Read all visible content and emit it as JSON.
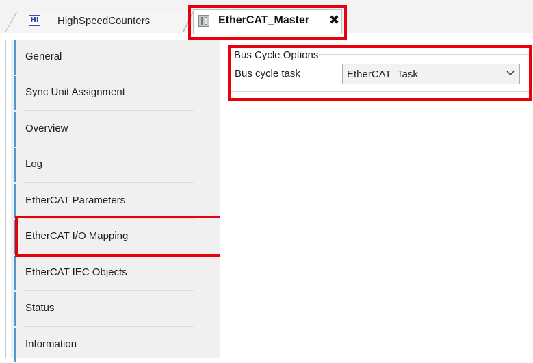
{
  "tabs": {
    "inactive_label": "HighSpeedCounters",
    "inactive_icon": "function-block-icon",
    "active_label": "EtherCAT_Master",
    "active_icon": "ethercat-master-icon",
    "close_glyph": "✖"
  },
  "nav": {
    "items": [
      {
        "label": "General"
      },
      {
        "label": "Sync Unit Assignment"
      },
      {
        "label": "Overview"
      },
      {
        "label": "Log"
      },
      {
        "label": "EtherCAT Parameters"
      },
      {
        "label": "EtherCAT I/O Mapping"
      },
      {
        "label": "EtherCAT IEC Objects"
      },
      {
        "label": "Status"
      },
      {
        "label": "Information"
      }
    ],
    "accent_color": "#4a9ad6"
  },
  "bus_cycle": {
    "group_title": "Bus Cycle Options",
    "field_label": "Bus cycle task",
    "selected_value": "EtherCAT_Task"
  },
  "highlight_color": "#e8000c"
}
